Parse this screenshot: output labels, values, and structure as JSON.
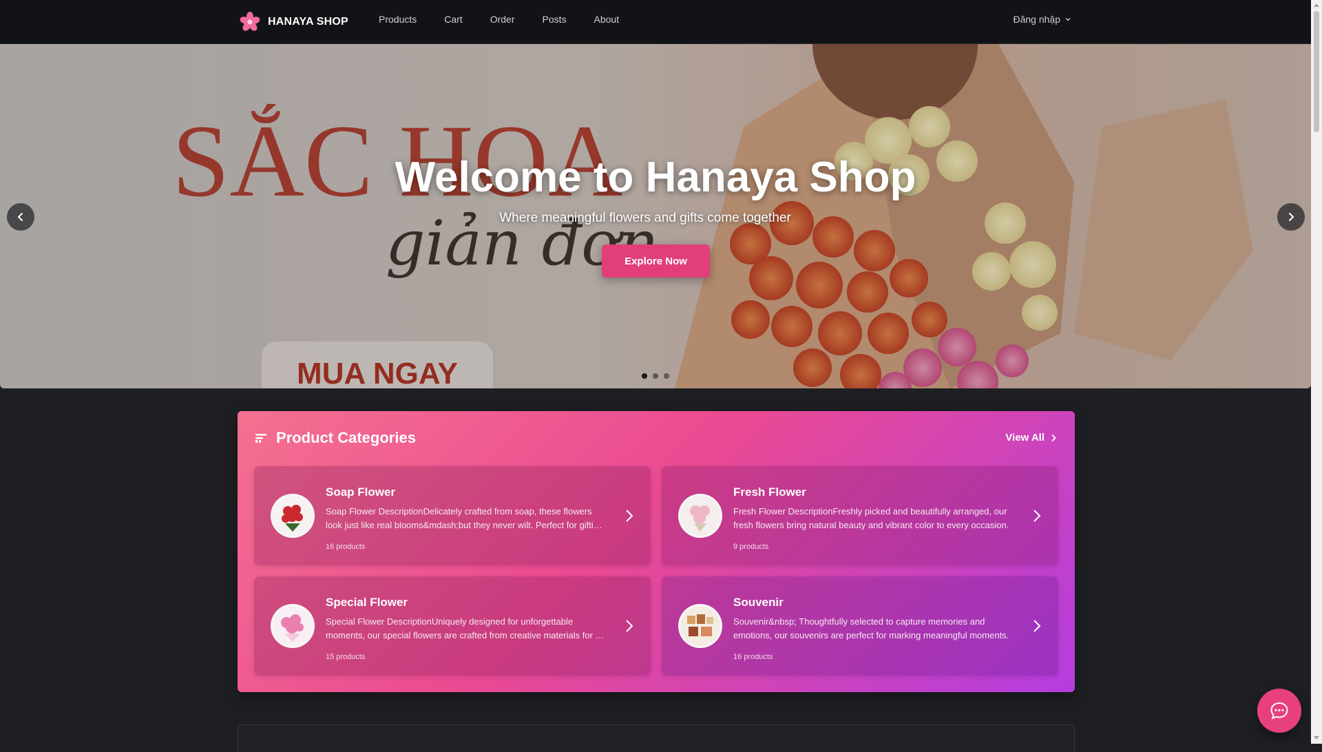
{
  "brand": {
    "name": "HANAYA SHOP",
    "logo_icon": "sakura-flower-icon",
    "accent": "#e23e79"
  },
  "nav": {
    "links": [
      "Products",
      "Cart",
      "Order",
      "Posts",
      "About"
    ],
    "login_label": "Đăng nhập"
  },
  "hero": {
    "title": "Welcome to Hanaya Shop",
    "subtitle": "Where meaningful flowers and gifts come together",
    "cta_label": "Explore Now",
    "banner_text": {
      "headline": "SẮC HOA",
      "script": "giản đơn",
      "badge": "MUA NGAY"
    },
    "slides": 3,
    "active_slide": 1
  },
  "categories": {
    "title": "Product Categories",
    "view_all_label": "View All",
    "items": [
      {
        "name": "Soap Flower",
        "description": "Soap Flower DescriptionDelicately crafted from soap, these flowers look just like real blooms&mdash;but they never wilt. Perfect for gifting and decoration.",
        "count": "16 products",
        "thumb_color": "#c9282e"
      },
      {
        "name": "Fresh Flower",
        "description": "Fresh Flower DescriptionFreshly picked and beautifully arranged, our fresh flowers bring natural beauty and vibrant color to every occasion.",
        "count": "9 products",
        "thumb_color": "#efb7c4"
      },
      {
        "name": "Special Flower",
        "description": "Special Flower DescriptionUniquely designed for unforgettable moments, our special flowers are crafted from creative materials for a lasting impression.",
        "count": "15 products",
        "thumb_color": "#ea7fb0"
      },
      {
        "name": "Souvenir",
        "description": "Souvenir&nbsp; Thoughtfully selected to capture memories and emotions, our souvenirs are perfect for marking meaningful moments.",
        "count": "16 products",
        "thumb_color": "#d9a062"
      }
    ]
  },
  "chat": {
    "icon": "chat-bubble-icon"
  }
}
